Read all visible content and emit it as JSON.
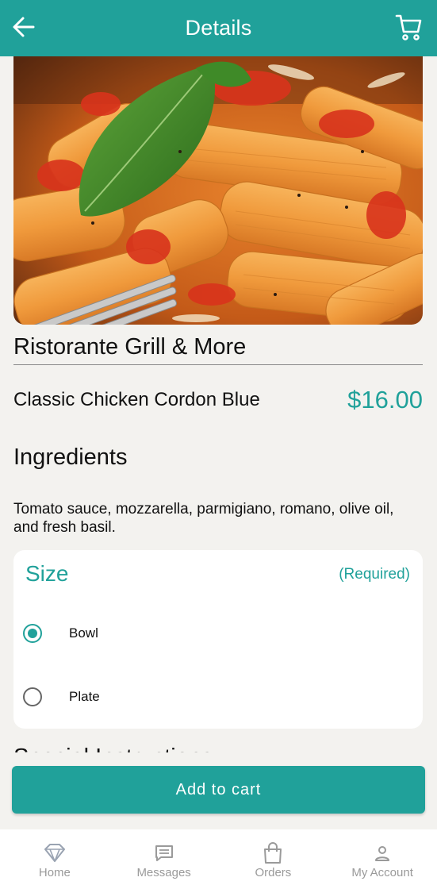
{
  "header": {
    "title": "Details",
    "back_icon": "arrow-left-icon",
    "cart_icon": "cart-icon",
    "color": "#20a19a"
  },
  "restaurant": {
    "name": "Ristorante Grill & More"
  },
  "item": {
    "name": "Classic Chicken Cordon Blue",
    "price": "$16.00"
  },
  "ingredients": {
    "title": "Ingredients",
    "text": "Tomato sauce, mozzarella, parmigiano, romano, olive oil, and fresh basil."
  },
  "size": {
    "title": "Size",
    "required_label": "(Required)",
    "options": [
      {
        "label": "Bowl",
        "selected": true
      },
      {
        "label": "Plate",
        "selected": false
      }
    ]
  },
  "special_instructions": {
    "title": "Special Instructions"
  },
  "add_to_cart": {
    "label": "Add to cart"
  },
  "bottom_nav": {
    "items": [
      {
        "label": "Home",
        "icon": "diamond-home-icon"
      },
      {
        "label": "Messages",
        "icon": "message-icon"
      },
      {
        "label": "Orders",
        "icon": "shopping-bag-icon"
      },
      {
        "label": "My Account",
        "icon": "person-icon"
      }
    ]
  },
  "colors": {
    "accent": "#20a19a",
    "background": "#f3f2ef"
  }
}
